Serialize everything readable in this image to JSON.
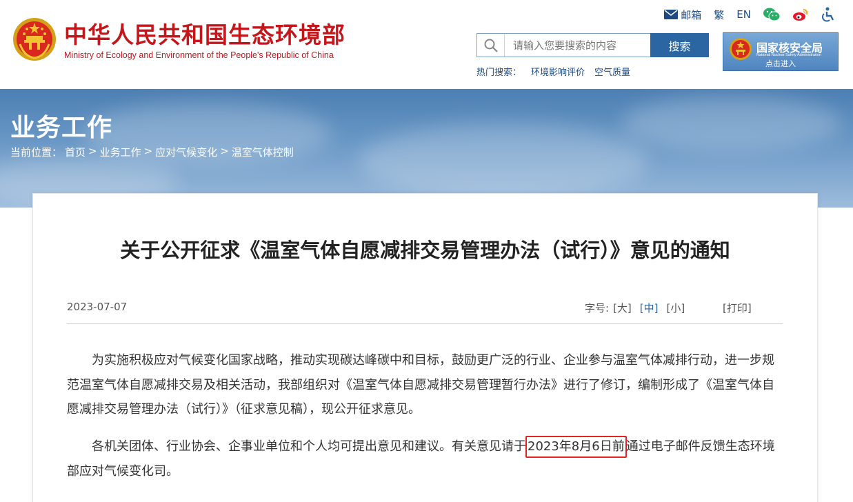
{
  "header": {
    "site_name": "中华人民共和国生态环境部",
    "site_name_en": "Ministry of Ecology and Environment of the People's Republic of China",
    "top_links": {
      "mail": "邮箱",
      "traditional": "繁",
      "english": "EN"
    },
    "icons": [
      "mail-icon",
      "wechat-icon",
      "weibo-icon",
      "accessibility-icon"
    ],
    "search": {
      "placeholder": "请输入您要搜索的内容",
      "button": "搜索"
    },
    "hot_search": {
      "label": "热门搜索：",
      "items": [
        "环境影响评价",
        "空气质量"
      ]
    },
    "nnsa": {
      "name": "国家核安全局",
      "name_en": "National Nuclear Safety Administration",
      "enter": "点击进入"
    }
  },
  "banner": {
    "section_title": "业务工作",
    "breadcrumb": {
      "label": "当前位置：",
      "items": [
        "首页",
        "业务工作",
        "应对气候变化",
        "温室气体控制"
      ],
      "separator": ">"
    }
  },
  "article": {
    "title": "关于公开征求《温室气体自愿减排交易管理办法（试行）》意见的通知",
    "date": "2023-07-07",
    "font_size": {
      "label": "字号:",
      "options": [
        "[大]",
        "[中]",
        "[小]"
      ],
      "active": "[中]"
    },
    "print": "[打印]",
    "para1": "为实施积极应对气候变化国家战略，推动实现碳达峰碳中和目标，鼓励更广泛的行业、企业参与温室气体减排行动，进一步规范温室气体自愿减排交易及相关活动，我部组织对《温室气体自愿减排交易管理暂行办法》进行了修订，编制形成了《温室气体自愿减排交易管理办法（试行）》（征求意见稿），现公开征求意见。",
    "para2_before": "各机关团体、行业协会、企事业单位和个人均可提出意见和建议。有关意见请于",
    "para2_highlight": "2023年8月6日前",
    "para2_after": "通过电子邮件反馈生态环境部应对气候变化司。"
  },
  "colors": {
    "brand_red": "#c2181c",
    "link_blue": "#1d4a84",
    "button_blue": "#2b66a2",
    "highlight_red": "#e32222"
  }
}
